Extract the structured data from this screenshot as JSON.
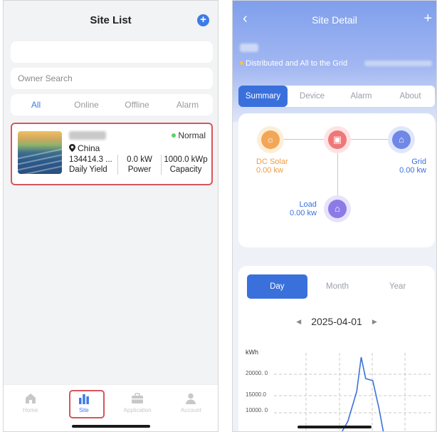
{
  "site_list": {
    "title": "Site List",
    "plus_icon": "plus-icon",
    "owner_search_placeholder": "Owner Search",
    "tabs": [
      {
        "label": "All",
        "active": true
      },
      {
        "label": "Online"
      },
      {
        "label": "Offline"
      },
      {
        "label": "Alarm"
      }
    ],
    "site": {
      "status": "Normal",
      "status_color": "#5bd46b",
      "location": "China",
      "yield_value": "134414.3 ...",
      "yield_label": "Daily Yield",
      "power_value": "0.0 kW",
      "power_label": "Power",
      "capacity_value": "1000.0 kWp",
      "capacity_label": "Capacity"
    },
    "nav": [
      {
        "label": "Home",
        "icon": "home-icon"
      },
      {
        "label": "Site",
        "icon": "bar-chart-icon",
        "active": true
      },
      {
        "label": "Application",
        "icon": "briefcase-icon"
      },
      {
        "label": "Account",
        "icon": "user-icon"
      }
    ],
    "accent": "#3d7be7",
    "highlight": "#d9545a"
  },
  "site_detail": {
    "title": "Site Detail",
    "type_label": "Distributed and All to the Grid",
    "tabs": [
      {
        "label": "Summary",
        "active": true
      },
      {
        "label": "Device"
      },
      {
        "label": "Alarm"
      },
      {
        "label": "About"
      }
    ],
    "flow": {
      "solar_label": "DC Solar",
      "solar_value": "0.00 kw",
      "grid_label": "Grid",
      "grid_value": "0.00 kw",
      "load_label": "Load",
      "load_value": "0.00 kw"
    },
    "period_tabs": [
      {
        "label": "Day",
        "active": true
      },
      {
        "label": "Month"
      },
      {
        "label": "Year"
      }
    ],
    "date": "2025-04-01",
    "chart_data": {
      "type": "line",
      "ylabel": "kWh",
      "yticks": [
        "20000.\n0",
        "15000.0",
        "10000.\n0"
      ],
      "points": [
        {
          "x": 0.0,
          "y": 0
        },
        {
          "x": 0.25,
          "y": 2000
        },
        {
          "x": 0.35,
          "y": 9000
        },
        {
          "x": 0.45,
          "y": 16000
        },
        {
          "x": 0.5,
          "y": 24000
        },
        {
          "x": 0.55,
          "y": 19000
        },
        {
          "x": 0.63,
          "y": 18500
        },
        {
          "x": 0.7,
          "y": 12000
        },
        {
          "x": 0.76,
          "y": 5000
        },
        {
          "x": 0.8,
          "y": 0
        }
      ]
    },
    "accent": "#3a70dc"
  }
}
